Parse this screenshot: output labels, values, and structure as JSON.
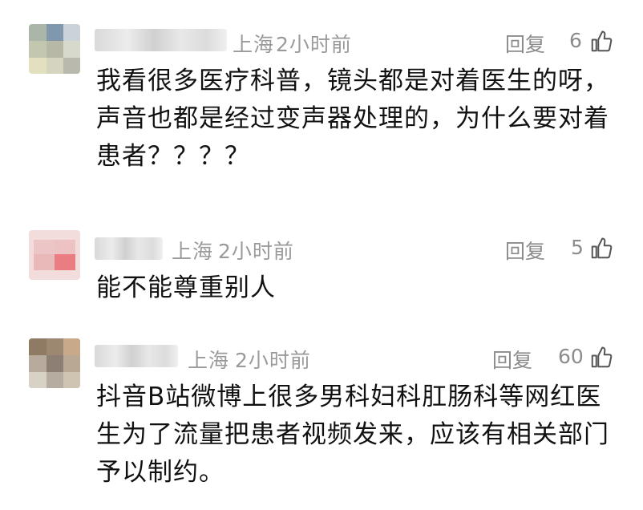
{
  "comments": [
    {
      "location": "上海",
      "time": "2小时前",
      "reply_label": "回复",
      "likes": "6",
      "text": "我看很多医疗科普，镜头都是对着医生的呀，声音也都是经过变声器处理的，为什么要对着患者？？？？"
    },
    {
      "location": "上海",
      "time": "2小时前",
      "reply_label": "回复",
      "likes": "5",
      "text": "能不能尊重别人"
    },
    {
      "location": "上海",
      "time": "2小时前",
      "reply_label": "回复",
      "likes": "60",
      "text": "抖音B站微博上很多男科妇科肛肠科等网红医生为了流量把患者视频发来，应该有相关部门予以制约。"
    }
  ],
  "colors": {
    "meta_text": "#9a9a9a",
    "body_text": "#111111",
    "action_text": "#8c8c8c"
  },
  "icons": {
    "like": "thumbs-up-outline-icon"
  }
}
